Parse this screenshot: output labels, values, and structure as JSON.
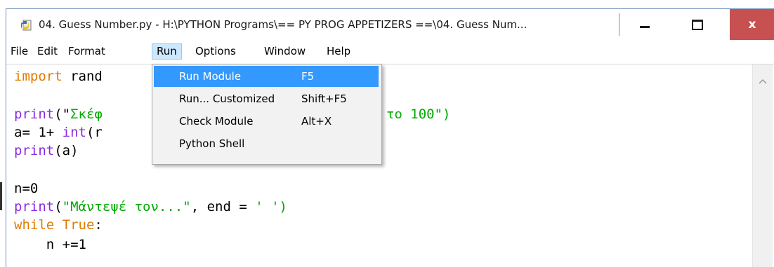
{
  "window": {
    "title": "04. Guess Number.py - H:\\PYTHON Programs\\== PY PROG APPETIZERS ==\\04. Guess Num...",
    "controls": {
      "minimize": "minimize",
      "maximize": "maximize",
      "close": "x"
    },
    "colors": {
      "close_bg": "#c75050",
      "highlight": "#3399ff",
      "active_menu": "#cce8ff"
    }
  },
  "menubar": {
    "items": [
      {
        "label": "File"
      },
      {
        "label": "Edit"
      },
      {
        "label": "Format"
      },
      {
        "label": "Run",
        "active": true
      },
      {
        "label": "Options"
      },
      {
        "label": "Window"
      },
      {
        "label": "Help"
      }
    ]
  },
  "run_menu": {
    "items": [
      {
        "label": "Run Module",
        "shortcut": "F5",
        "highlighted": true
      },
      {
        "label": "Run... Customized",
        "shortcut": "Shift+F5"
      },
      {
        "label": "Check Module",
        "shortcut": "Alt+X"
      },
      {
        "label": "Python Shell",
        "shortcut": ""
      }
    ]
  },
  "editor": {
    "lines": [
      {
        "keyword": "import",
        "rest": " rand"
      },
      {
        "builtin": "print",
        "open": "(\"",
        "str1": "Σκέφ",
        "str2": " το 1 ως το 100\")"
      },
      {
        "pre": "a= 1+ ",
        "builtin": "int",
        "post": "(r"
      },
      {
        "builtin": "print",
        "post": "(a)"
      },
      {
        "post": "n=0"
      },
      {
        "builtin": "print",
        "open": "(",
        "str": "\"Μάντεψέ τον...\"",
        "post": ", end = ",
        "str_end": "' ')"
      },
      {
        "keyword": "while",
        "kw2": "True",
        "post": ":"
      },
      {
        "post": "    n +=1"
      }
    ]
  },
  "icons": {
    "app": "python-file-icon",
    "scroll_up": "scroll-up-arrow-icon"
  }
}
